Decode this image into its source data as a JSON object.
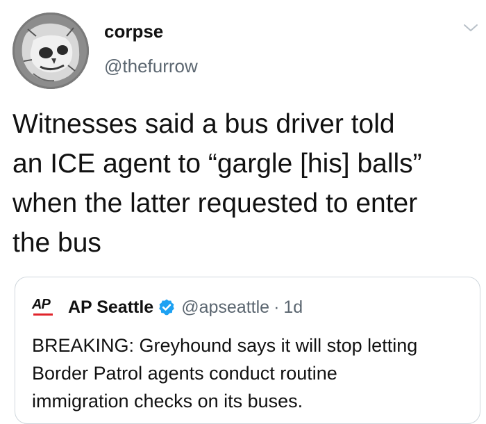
{
  "tweet": {
    "display_name": "corpse",
    "handle": "@thefurrow",
    "text_lines": [
      "Witnesses said a bus driver told",
      "an ICE agent to “gargle [his] balls”",
      "when the latter requested to enter",
      "the bus"
    ],
    "menu_icon": "chevron-down-icon",
    "avatar_icon": "skull-avatar"
  },
  "quote": {
    "logo_text": "AP",
    "name": "AP Seattle",
    "verified_icon": "verified-badge-icon",
    "handle": "@apseattle",
    "separator": "·",
    "time": "1d",
    "text_lines": [
      "BREAKING: Greyhound says it will stop letting",
      "Border Patrol agents conduct routine",
      "immigration checks on its buses."
    ]
  },
  "colors": {
    "text": "#111111",
    "secondary_text": "#5b6670",
    "card_border": "#cfd6dc",
    "verified_blue": "#1da1f2",
    "ap_red": "#e0242b"
  }
}
